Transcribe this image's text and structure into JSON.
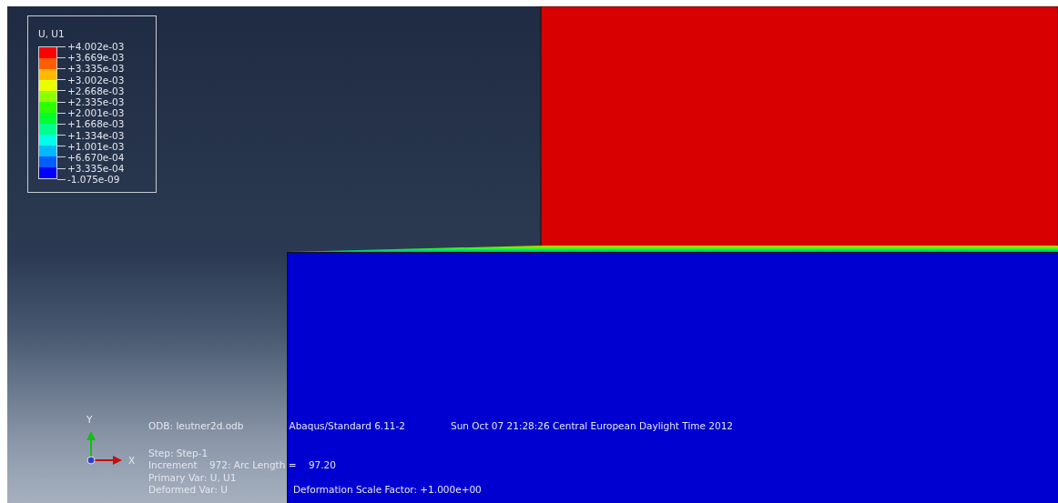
{
  "legend": {
    "title": "U, U1",
    "values": [
      "+4.002e-03",
      "+3.669e-03",
      "+3.335e-03",
      "+3.002e-03",
      "+2.668e-03",
      "+2.335e-03",
      "+2.001e-03",
      "+1.668e-03",
      "+1.334e-03",
      "+1.001e-03",
      "+6.670e-04",
      "+3.335e-04",
      "-1.075e-09"
    ],
    "bands": [
      {
        "color": "#ff0000"
      },
      {
        "color": "#ff5d00"
      },
      {
        "color": "#ffb900"
      },
      {
        "color": "#e9ff00"
      },
      {
        "color": "#8cff00"
      },
      {
        "color": "#2eff00"
      },
      {
        "color": "#00ff2e"
      },
      {
        "color": "#00ff8b"
      },
      {
        "color": "#00ffe8"
      },
      {
        "color": "#00b9ff"
      },
      {
        "color": "#005dff"
      },
      {
        "color": "#0000ff"
      }
    ]
  },
  "triad": {
    "y_label": "Y",
    "x_label": "X"
  },
  "info": {
    "header": [
      "ODB: leutner2d.odb",
      "Abaqus/Standard 6.11-2",
      "Sun Oct 07 21:28:26 Central European Daylight Time 2012"
    ],
    "lines": [
      [
        "Step: Step-1"
      ],
      [
        "Increment    972: Arc Length =    97.20"
      ],
      [
        "Primary Var: U, U1"
      ],
      [
        "Deformed Var: U",
        "Deformation Scale Factor: +1.000e+00"
      ]
    ]
  }
}
